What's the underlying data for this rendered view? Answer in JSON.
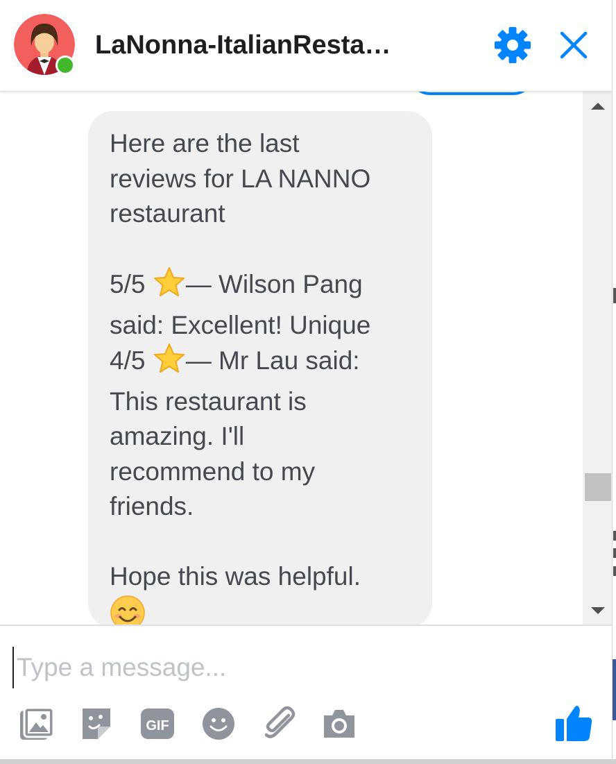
{
  "header": {
    "title": "LaNonna-ItalianResta…",
    "avatar_icon": "waiter-avatar-icon",
    "settings_icon": "gear-icon",
    "close_icon": "close-icon",
    "accent": "#0084ff",
    "presence_color": "#42b72a"
  },
  "message": {
    "intro": "Here are the last\nreviews for LA NANNO\nrestaurant",
    "review1_rating": "5/5",
    "review1_text": "— Wilson Pang\nsaid: Excellent! Unique",
    "review2_rating": "4/5",
    "review2_text": "— Mr Lau said:\nThis restaurant is\namazing. I'll\nrecommend to my\nfriends.",
    "closing": "Hope this was helpful.",
    "star_icon": "star-emoji-icon",
    "smile_icon": "smiling-face-emoji-icon",
    "bubble_color": "#f1f0f0"
  },
  "composer": {
    "placeholder": "Type a message...",
    "tools": [
      "photo-icon",
      "sticker-icon",
      "gif-icon",
      "emoji-icon",
      "attachment-icon",
      "camera-icon"
    ],
    "gif_label": "GIF",
    "like_icon": "thumbs-up-icon"
  }
}
